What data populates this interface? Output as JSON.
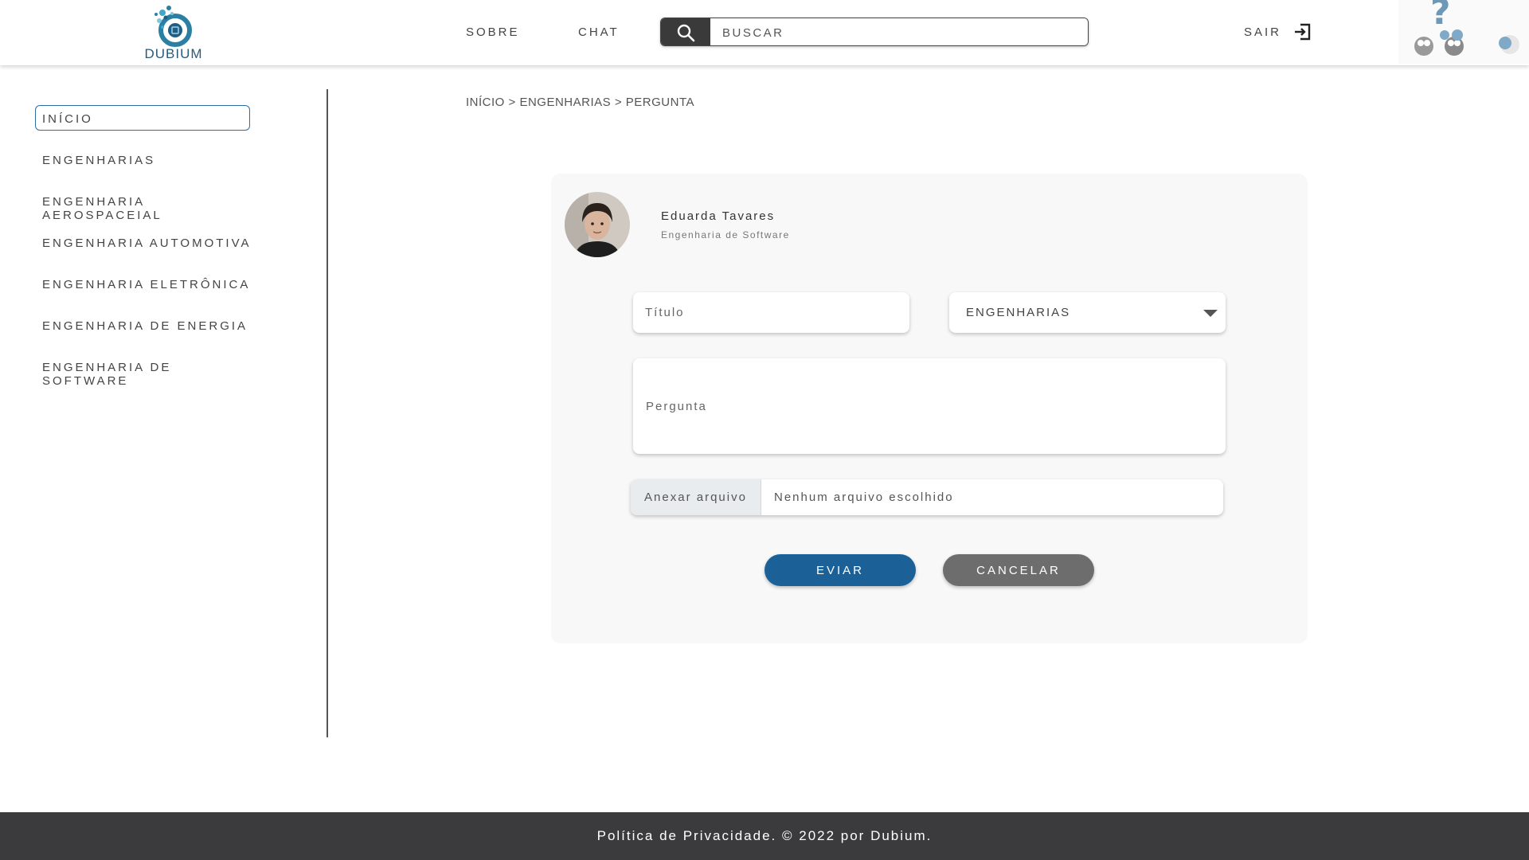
{
  "header": {
    "logo_text": "DUBIUM",
    "nav": [
      "SOBRE",
      "CHAT"
    ],
    "search": {
      "placeholder": "BUSCAR",
      "value": ""
    },
    "logout_label": "SAIR"
  },
  "sidebar": {
    "items": [
      {
        "label": "INÍCIO",
        "active": true
      },
      {
        "label": "ENGENHARIAS",
        "active": false
      },
      {
        "label": "ENGENHARIA AEROSPACEIAL",
        "active": false
      },
      {
        "label": "ENGENHARIA AUTOMOTIVA",
        "active": false
      },
      {
        "label": "ENGENHARIA ELETRÔNICA",
        "active": false
      },
      {
        "label": "ENGENHARIA DE ENERGIA",
        "active": false
      },
      {
        "label": "ENGENHARIA DE SOFTWARE",
        "active": false
      }
    ]
  },
  "breadcrumb": {
    "items": [
      "INÍCIO",
      "ENGENHARIAS",
      "PERGUNTA"
    ],
    "separator": " > "
  },
  "form": {
    "user_name": "Eduarda Tavares",
    "user_department": "Engenharia de Software",
    "title_placeholder": "Título",
    "category_selected": "ENGENHARIAS",
    "question_placeholder": "Pergunta",
    "file_button_label": "Anexar arquivo",
    "file_status": "Nenhum arquivo escolhido",
    "submit_label": "EVIAR",
    "cancel_label": "CANCELAR"
  },
  "footer": {
    "text": "Política de Privacidade. © 2022 por Dubium."
  },
  "colors": {
    "primary": "#1b6198",
    "secondary": "#6d6d6d",
    "footer": "#3b3b3d",
    "active_border": "#2c6fa4",
    "card": "#f8f8f8"
  }
}
